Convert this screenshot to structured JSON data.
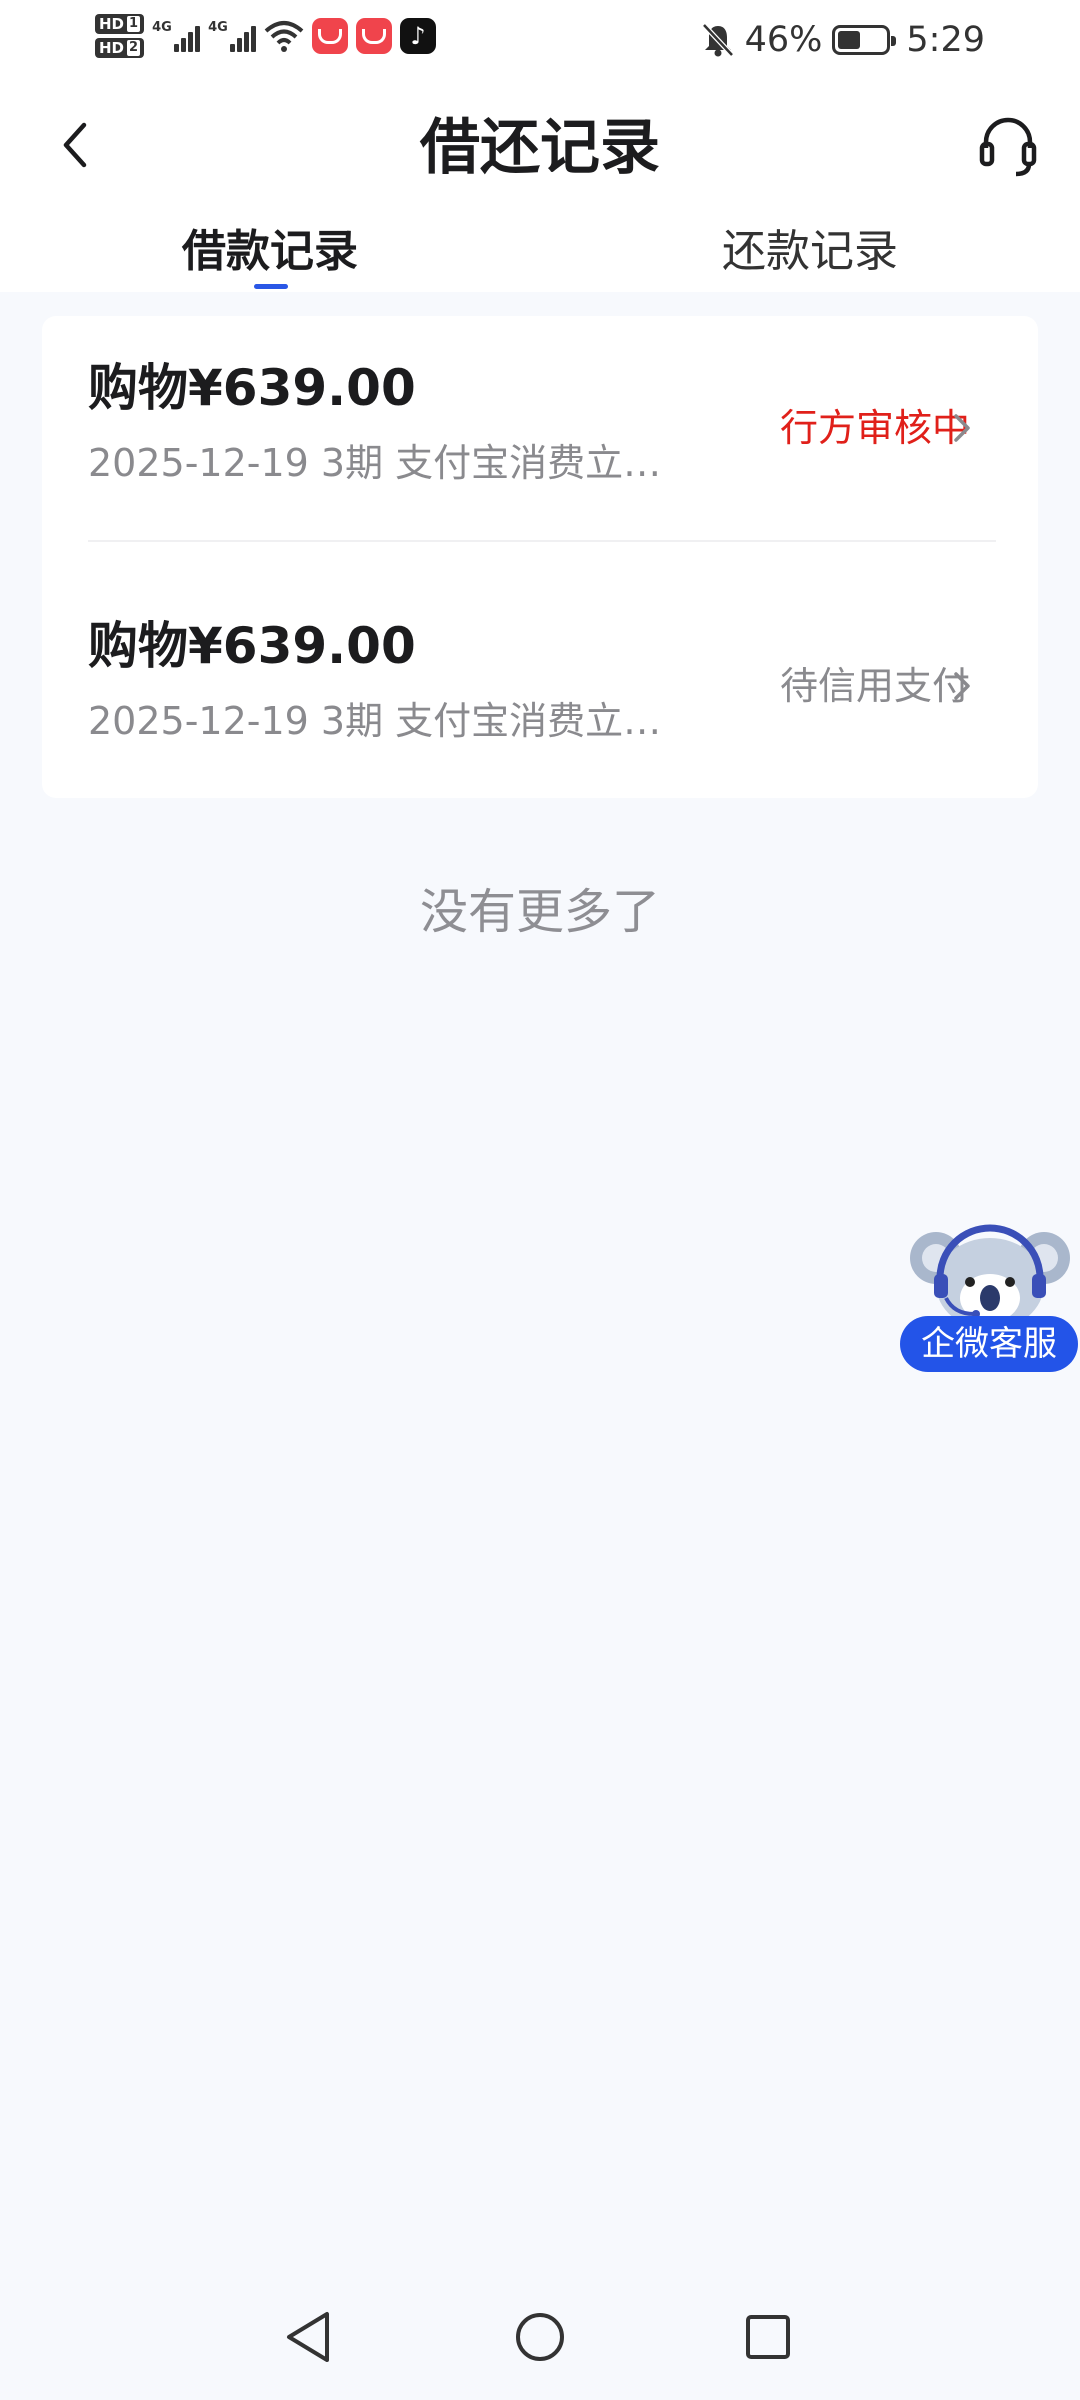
{
  "status_bar": {
    "hd1": "HD",
    "hd1_sim": "1",
    "hd2": "HD",
    "hd2_sim": "2",
    "net1": "4G",
    "net2": "4G",
    "battery_percent": "46%",
    "battery_level": 0.46,
    "time": "5:29",
    "icons": [
      "signal-icon",
      "wifi-icon",
      "huawei-appgallery-icon",
      "tiktok-icon",
      "bell-muted-icon",
      "battery-icon"
    ]
  },
  "header": {
    "title": "借还记录",
    "back_icon": "chevron-left-icon",
    "service_icon": "headset-icon"
  },
  "tabs": [
    {
      "label": "借款记录",
      "active": true
    },
    {
      "label": "还款记录",
      "active": false
    }
  ],
  "records": [
    {
      "amount": "购物¥639.00",
      "subtitle": "2025-12-19 3期  支付宝消费立…",
      "status": "行方审核中",
      "status_color": "#e0201a"
    },
    {
      "amount": "购物¥639.00",
      "subtitle": "2025-12-19 3期  支付宝消费立…",
      "status": "待信用支付",
      "status_color": "#8a8a8e"
    }
  ],
  "list_footer": "没有更多了",
  "floating_service": {
    "label": "企微客服",
    "icon": "koala-headset-icon"
  },
  "colors": {
    "accent": "#2a57e6",
    "background": "#f7f9fd"
  }
}
